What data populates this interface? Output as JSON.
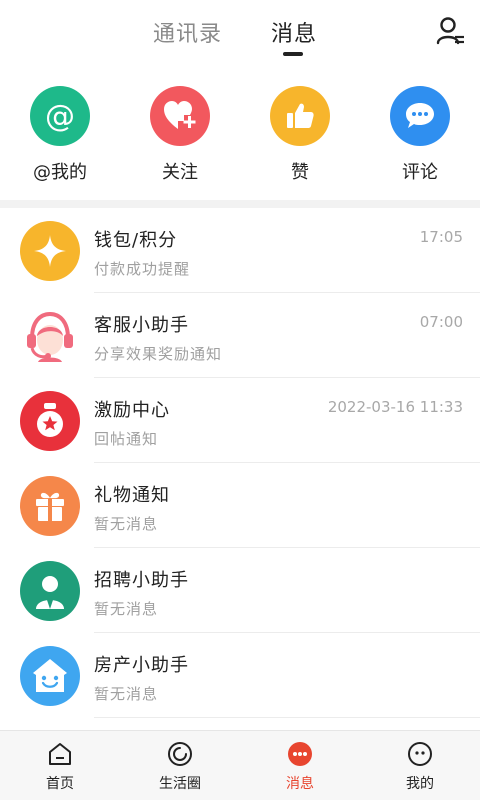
{
  "header": {
    "tabs": [
      {
        "label": "通讯录"
      },
      {
        "label": "消息"
      }
    ],
    "active_tab": "消息"
  },
  "quick_actions": [
    {
      "label": "@我的",
      "icon": "at-icon",
      "color": "#1eb98a"
    },
    {
      "label": "关注",
      "icon": "heart-plus-icon",
      "color": "#f2585e"
    },
    {
      "label": "赞",
      "icon": "thumbs-up-icon",
      "color": "#f7b52c"
    },
    {
      "label": "评论",
      "icon": "comment-bubble-icon",
      "color": "#2f8ff0"
    }
  ],
  "messages": [
    {
      "title": "钱包/积分",
      "subtitle": "付款成功提醒",
      "time": "17:05",
      "icon": "sparkle-icon",
      "color": "#f7b52c"
    },
    {
      "title": "客服小助手",
      "subtitle": "分享效果奖励通知",
      "time": "07:00",
      "icon": "customer-service-icon",
      "color": "#f06b7e"
    },
    {
      "title": "激励中心",
      "subtitle": "回帖通知",
      "time": "2022-03-16 11:33",
      "icon": "medal-icon",
      "color": "#e8313b"
    },
    {
      "title": "礼物通知",
      "subtitle": "暂无消息",
      "time": "",
      "icon": "gift-icon",
      "color": "#f5874a"
    },
    {
      "title": "招聘小助手",
      "subtitle": "暂无消息",
      "time": "",
      "icon": "recruiter-icon",
      "color": "#1f9e7a"
    },
    {
      "title": "房产小助手",
      "subtitle": "暂无消息",
      "time": "",
      "icon": "house-icon",
      "color": "#3fa6f0"
    }
  ],
  "bottom_nav": [
    {
      "label": "首页",
      "icon": "home-icon"
    },
    {
      "label": "生活圈",
      "icon": "life-circle-icon"
    },
    {
      "label": "消息",
      "icon": "message-dots-icon",
      "active": true,
      "color": "#e8452f"
    },
    {
      "label": "我的",
      "icon": "profile-face-icon"
    }
  ]
}
